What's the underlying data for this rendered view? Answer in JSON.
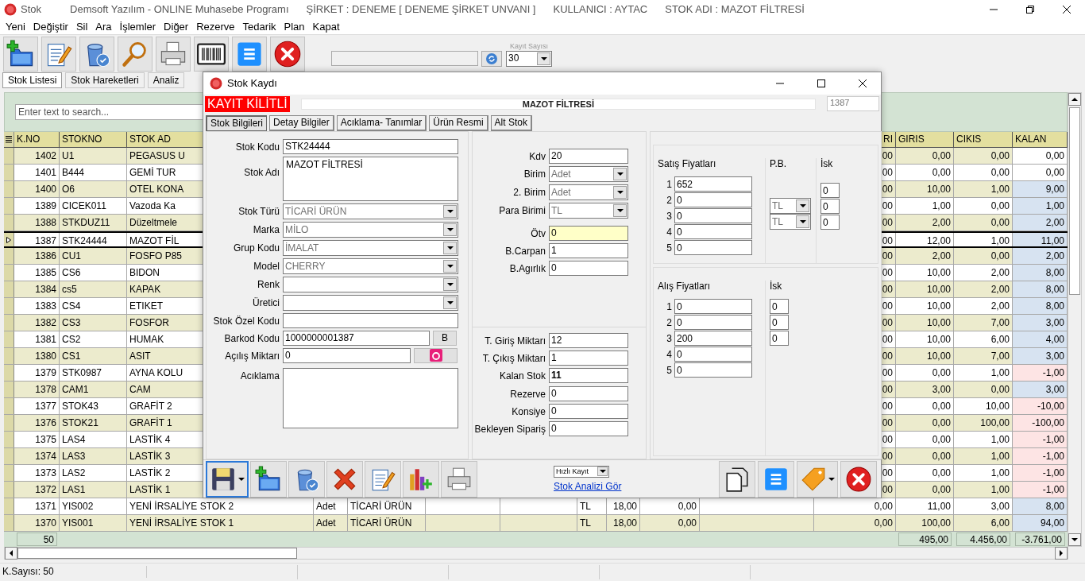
{
  "window": {
    "title": "Stok",
    "captions": [
      "Demsoft Yazılım - ONLINE Muhasebe Programı",
      "ŞİRKET : DENEME [ DENEME ŞİRKET UNVANI ]",
      "KULLANICI : AYTAC",
      "STOK ADI : MAZOT FİLTRESİ"
    ]
  },
  "menu": [
    "Yeni",
    "Değiştir",
    "Sil",
    "Ara",
    "İşlemler",
    "Diğer",
    "Rezerve",
    "Tedarik",
    "Plan",
    "Kapat"
  ],
  "toolbar": {
    "buttons": [
      {
        "kind": "new"
      },
      {
        "kind": "edit"
      },
      {
        "kind": "delete"
      },
      {
        "kind": "search"
      },
      {
        "kind": "print"
      },
      {
        "kind": "barcode"
      },
      {
        "kind": "list"
      },
      {
        "kind": "close"
      }
    ],
    "record_count": {
      "label": "Kayıt Sayısı",
      "value": "30"
    }
  },
  "tabs": [
    {
      "label": "Stok Listesi",
      "selected": true
    },
    {
      "label": "Stok Hareketleri",
      "selected": false
    },
    {
      "label": "Analiz",
      "selected": false
    }
  ],
  "grid": {
    "search": {
      "placeholder": "Enter text to search..."
    },
    "columns": [
      "K.NO",
      "STOKNO",
      "STOK AD",
      null,
      null,
      null,
      null,
      null,
      null,
      null,
      null,
      "RI",
      "GIRIS",
      "CIKIS",
      "KALAN"
    ],
    "rows": [
      {
        "selected": false,
        "color": "#ffffff",
        "cells": [
          "1402",
          "U1",
          "PEGASUS U",
          null,
          null,
          null,
          null,
          null,
          null,
          null,
          null,
          "00",
          "0,00",
          "0,00",
          "0,00"
        ]
      },
      {
        "selected": false,
        "color": "#ffffff",
        "cells": [
          "1401",
          "B444",
          "GEMİ TUR",
          null,
          null,
          null,
          null,
          null,
          null,
          null,
          null,
          "00",
          "0,00",
          "0,00",
          "0,00"
        ]
      },
      {
        "selected": false,
        "color": "#d7e3f1",
        "cells": [
          "1400",
          "O6",
          "OTEL KONA",
          null,
          null,
          null,
          null,
          null,
          null,
          null,
          null,
          "00",
          "10,00",
          "1,00",
          "9,00"
        ]
      },
      {
        "selected": false,
        "color": "#d7e3f1",
        "cells": [
          "1389",
          "CICEK011",
          "Vazoda Ka",
          null,
          null,
          null,
          null,
          null,
          null,
          null,
          null,
          "00",
          "1,00",
          "0,00",
          "1,00"
        ]
      },
      {
        "selected": false,
        "color": "#d7e3f1",
        "cells": [
          "1388",
          "STKDUZ11",
          "Düzeltmele",
          null,
          null,
          null,
          null,
          null,
          null,
          null,
          null,
          "00",
          "2,00",
          "0,00",
          "2,00"
        ]
      },
      {
        "selected": true,
        "color": "#d7e3f1",
        "cells": [
          "1387",
          "STK24444",
          "MAZOT FİL",
          null,
          null,
          null,
          null,
          null,
          null,
          null,
          null,
          "00",
          "12,00",
          "1,00",
          "11,00"
        ]
      },
      {
        "selected": false,
        "color": "#d7e3f1",
        "cells": [
          "1386",
          "CU1",
          "FOSFO P85",
          null,
          null,
          null,
          null,
          null,
          null,
          null,
          null,
          "00",
          "2,00",
          "0,00",
          "2,00"
        ]
      },
      {
        "selected": false,
        "color": "#d7e3f1",
        "cells": [
          "1385",
          "CS6",
          "BIDON",
          null,
          null,
          null,
          null,
          null,
          null,
          null,
          null,
          "00",
          "10,00",
          "2,00",
          "8,00"
        ]
      },
      {
        "selected": false,
        "color": "#d7e3f1",
        "cells": [
          "1384",
          "cs5",
          "KAPAK",
          null,
          null,
          null,
          null,
          null,
          null,
          null,
          null,
          "00",
          "10,00",
          "2,00",
          "8,00"
        ]
      },
      {
        "selected": false,
        "color": "#d7e3f1",
        "cells": [
          "1383",
          "CS4",
          "ETIKET",
          null,
          null,
          null,
          null,
          null,
          null,
          null,
          null,
          "00",
          "10,00",
          "2,00",
          "8,00"
        ]
      },
      {
        "selected": false,
        "color": "#d7e3f1",
        "cells": [
          "1382",
          "CS3",
          "FOSFOR",
          null,
          null,
          null,
          null,
          null,
          null,
          null,
          null,
          "00",
          "10,00",
          "7,00",
          "3,00"
        ]
      },
      {
        "selected": false,
        "color": "#d7e3f1",
        "cells": [
          "1381",
          "CS2",
          "HUMAK",
          null,
          null,
          null,
          null,
          null,
          null,
          null,
          null,
          "00",
          "10,00",
          "6,00",
          "4,00"
        ]
      },
      {
        "selected": false,
        "color": "#d7e3f1",
        "cells": [
          "1380",
          "CS1",
          "ASIT",
          null,
          null,
          null,
          null,
          null,
          null,
          null,
          null,
          "00",
          "10,00",
          "7,00",
          "3,00"
        ]
      },
      {
        "selected": false,
        "color": "#fde4e4",
        "cells": [
          "1379",
          "STK0987",
          "AYNA KOLU",
          null,
          null,
          null,
          null,
          null,
          null,
          null,
          null,
          "00",
          "0,00",
          "1,00",
          "-1,00"
        ]
      },
      {
        "selected": false,
        "color": "#d7e3f1",
        "cells": [
          "1378",
          "CAM1",
          "CAM",
          null,
          null,
          null,
          null,
          null,
          null,
          null,
          null,
          "00",
          "3,00",
          "0,00",
          "3,00"
        ]
      },
      {
        "selected": false,
        "color": "#fde4e4",
        "cells": [
          "1377",
          "STOK43",
          "GRAFİT 2",
          null,
          null,
          null,
          null,
          null,
          null,
          null,
          null,
          "00",
          "0,00",
          "10,00",
          "-10,00"
        ]
      },
      {
        "selected": false,
        "color": "#fde4e4",
        "cells": [
          "1376",
          "STOK21",
          "GRAFİT 1",
          null,
          null,
          null,
          null,
          null,
          null,
          null,
          null,
          "00",
          "0,00",
          "100,00",
          "-100,00"
        ]
      },
      {
        "selected": false,
        "color": "#fde4e4",
        "cells": [
          "1375",
          "LAS4",
          "LASTİK 4",
          null,
          null,
          null,
          null,
          null,
          null,
          null,
          null,
          "00",
          "0,00",
          "1,00",
          "-1,00"
        ]
      },
      {
        "selected": false,
        "color": "#fde4e4",
        "cells": [
          "1374",
          "LAS3",
          "LASTİK 3",
          null,
          null,
          null,
          null,
          null,
          null,
          null,
          null,
          "00",
          "0,00",
          "1,00",
          "-1,00"
        ]
      },
      {
        "selected": false,
        "color": "#fde4e4",
        "cells": [
          "1373",
          "LAS2",
          "LASTİK 2",
          null,
          null,
          null,
          null,
          null,
          null,
          null,
          null,
          "00",
          "0,00",
          "1,00",
          "-1,00"
        ]
      },
      {
        "selected": false,
        "color": "#fde4e4",
        "cells": [
          "1372",
          "LAS1",
          "LASTİK 1",
          null,
          null,
          null,
          null,
          null,
          null,
          null,
          null,
          "00",
          "0,00",
          "1,00",
          "-1,00"
        ]
      },
      {
        "selected": false,
        "color": "#d7e3f1",
        "cells": [
          "1371",
          "YIS002",
          "YENİ İRSALİYE STOK 2",
          "Adet",
          "TİCARİ ÜRÜN",
          null,
          null,
          "TL",
          "18,00",
          "0,00",
          null,
          "0,00",
          "11,00",
          "3,00",
          "8,00"
        ]
      },
      {
        "selected": false,
        "color": "#d7e3f1",
        "cells": [
          "1370",
          "YIS001",
          "YENİ İRSALİYE STOK 1",
          "Adet",
          "TİCARİ ÜRÜN",
          null,
          null,
          "TL",
          "18,00",
          "0,00",
          null,
          "0,00",
          "100,00",
          "6,00",
          "94,00"
        ]
      }
    ],
    "totals": {
      "k_no": "50",
      "giris": "495,00",
      "cikis": "4.456,00",
      "kalan": "-3.761,00"
    }
  },
  "dialog": {
    "title": "Stok Kaydı",
    "lock_label": "KAYIT KİLİTLİ",
    "record_name": "MAZOT FİLTRESİ",
    "record_no": "1387",
    "tabs": [
      {
        "label": "Stok Bilgileri",
        "selected": true
      },
      {
        "label": "Detay Bilgiler",
        "selected": false
      },
      {
        "label": "Acıklama- Tanımlar",
        "selected": false
      },
      {
        "label": "Ürün Resmi",
        "selected": false
      },
      {
        "label": "Alt Stok",
        "selected": false
      }
    ],
    "general_fields": [
      {
        "label": "Stok Kodu",
        "kind": "text",
        "value": "STK24444"
      },
      {
        "label": "Stok Adı",
        "kind": "memo",
        "value": "MAZOT FİLTRESİ"
      },
      {
        "label": "Stok Türü",
        "kind": "combo",
        "value": "TİCARİ ÜRÜN"
      },
      {
        "label": "Marka",
        "kind": "combo",
        "value": "MİLO"
      },
      {
        "label": "Grup Kodu",
        "kind": "combo",
        "value": "İMALAT"
      },
      {
        "label": "Model",
        "kind": "combo",
        "value": "CHERRY"
      },
      {
        "label": "Renk",
        "kind": "combo"
      },
      {
        "label": "Üretici",
        "kind": "combo"
      },
      {
        "label": "Stok Özel Kodu",
        "kind": "text"
      },
      {
        "label": "Barkod Kodu",
        "kind": "text_button",
        "value": "1000000001387",
        "button": "B"
      },
      {
        "label": "Açılış Miktarı",
        "kind": "text_icon_button",
        "value": "0"
      },
      {
        "label": "Acıklama",
        "kind": "memo"
      }
    ],
    "unit_fields": [
      {
        "label": "Kdv",
        "kind": "text",
        "value": "20"
      },
      {
        "label": "Birim",
        "kind": "combo",
        "value": "Adet"
      },
      {
        "label": "2. Birim",
        "kind": "combo",
        "value": "Adet"
      },
      {
        "label": "Para Birimi",
        "kind": "combo",
        "value": "TL"
      }
    ],
    "tax_fields": [
      {
        "label": "Ötv",
        "kind": "text",
        "value": "0",
        "highlighted": true
      },
      {
        "label": "B.Carpan",
        "kind": "text",
        "value": "1",
        "highlighted": false
      },
      {
        "label": "B.Agırlık",
        "kind": "text",
        "value": "0",
        "highlighted": false
      }
    ],
    "quantity_fields": [
      {
        "label": "T. Giriş Miktarı",
        "kind": "text",
        "value": "12",
        "emphasized": false
      },
      {
        "label": "T. Çıkış Miktarı",
        "kind": "text",
        "value": "1",
        "emphasized": false
      },
      {
        "label": "Kalan Stok",
        "kind": "text",
        "value": "11",
        "emphasized": true
      }
    ],
    "order_fields": [
      {
        "label": "Rezerve",
        "kind": "text",
        "value": "0"
      },
      {
        "label": "Konsiye",
        "kind": "text",
        "value": "0"
      },
      {
        "label": "Bekleyen Sipariş",
        "kind": "text",
        "value": "0"
      }
    ],
    "sales_prices": {
      "title": "Satış Fiyatları",
      "prices": [
        {
          "index": "1",
          "value": "652"
        },
        {
          "index": "2",
          "value": "0"
        },
        {
          "index": "3",
          "value": "0"
        },
        {
          "index": "4",
          "value": "0"
        },
        {
          "index": "5",
          "value": "0"
        }
      ],
      "currency_title": "P.B.",
      "currencies": [
        "TL",
        "TL"
      ],
      "discount_title": "İsk",
      "discounts": [
        "0",
        "0",
        "0"
      ]
    },
    "purchase_prices": {
      "title": "Alış Fiyatları",
      "prices": [
        {
          "index": "1",
          "value": "0"
        },
        {
          "index": "2",
          "value": "0"
        },
        {
          "index": "3",
          "value": "200"
        },
        {
          "index": "4",
          "value": "0"
        },
        {
          "index": "5",
          "value": "0"
        }
      ],
      "discount_title": "İsk",
      "discounts": [
        "0",
        "0",
        "0"
      ]
    },
    "actions": [
      {
        "kind": "save",
        "focused": true,
        "dropdown": true
      },
      {
        "kind": "new",
        "focused": false,
        "dropdown": false
      },
      {
        "kind": "delete",
        "focused": false,
        "dropdown": false
      },
      {
        "kind": "cancel",
        "focused": false,
        "dropdown": false
      },
      {
        "kind": "edit",
        "focused": false,
        "dropdown": false
      },
      {
        "kind": "chart",
        "focused": false,
        "dropdown": false
      },
      {
        "kind": "print",
        "focused": false,
        "dropdown": false
      }
    ],
    "quick_save": "Hızlı Kayıt",
    "analysis_link": "Stok Analizi Gör",
    "right_actions": [
      {
        "kind": "copy",
        "focused": false,
        "dropdown": false
      },
      {
        "kind": "list",
        "focused": false,
        "dropdown": false
      },
      {
        "kind": "tag",
        "focused": false,
        "dropdown": true
      },
      {
        "kind": "close",
        "focused": false,
        "dropdown": false
      }
    ]
  },
  "status_bar": {
    "text": "K.Sayısı: 50"
  }
}
